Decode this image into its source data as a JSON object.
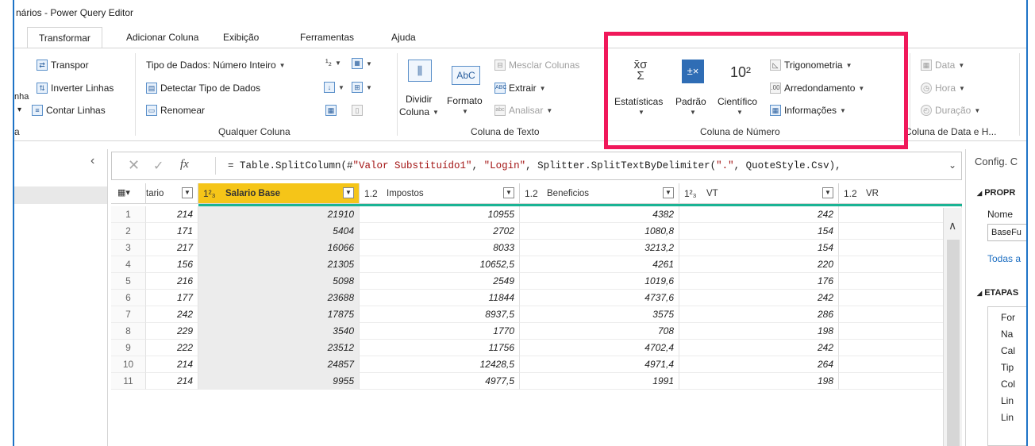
{
  "window": {
    "title": "nários - Power Query Editor"
  },
  "tabs": [
    "Transformar",
    "Adicionar Coluna",
    "Exibição",
    "Ferramentas",
    "Ajuda"
  ],
  "ribbon": {
    "group0": {
      "label": "a",
      "partial_text": "nha"
    },
    "group1": {
      "transpor": "Transpor",
      "inverter": "Inverter Linhas",
      "contar": "Contar Linhas"
    },
    "qualquer": {
      "tipo_dados": "Tipo de Dados: Número Inteiro",
      "detectar": "Detectar Tipo de Dados",
      "renomear": "Renomear",
      "label": "Qualquer Coluna"
    },
    "texto": {
      "dividir": "Dividir",
      "coluna": "Coluna",
      "formato": "Formato",
      "mesclar": "Mesclar Colunas",
      "extrair": "Extrair",
      "analisar": "Analisar",
      "label": "Coluna de Texto"
    },
    "numero": {
      "estatisticas": "Estatísticas",
      "padrao": "Padrão",
      "cientifico": "Científico",
      "trigonometria": "Trigonometria",
      "arredondamento": "Arredondamento",
      "informacoes": "Informações",
      "label": "Coluna de Número"
    },
    "data": {
      "data": "Data",
      "hora": "Hora",
      "duracao": "Duração",
      "label": "Coluna de Data e H..."
    }
  },
  "formula": {
    "fx": "fx",
    "prefix": "= Table.SplitColumn(#",
    "str1": "\"Valor Substituído1\"",
    "mid1": ", ",
    "str2": "\"Login\"",
    "mid2": ", Splitter.SplitTextByDelimiter(",
    "str3": "\".\"",
    "suffix": ", QuoteStyle.Csv),"
  },
  "table": {
    "columns": [
      {
        "type": "",
        "name": "tario"
      },
      {
        "type": "1²₃",
        "name": "Salario Base"
      },
      {
        "type": "1.2",
        "name": "Impostos"
      },
      {
        "type": "1.2",
        "name": "Beneficios"
      },
      {
        "type": "1²₃",
        "name": "VT"
      },
      {
        "type": "1.2",
        "name": "VR"
      }
    ],
    "rows": [
      [
        "1",
        "214",
        "21910",
        "10955",
        "4382",
        "242",
        ""
      ],
      [
        "2",
        "171",
        "5404",
        "2702",
        "1080,8",
        "154",
        ""
      ],
      [
        "3",
        "217",
        "16066",
        "8033",
        "3213,2",
        "154",
        ""
      ],
      [
        "4",
        "156",
        "21305",
        "10652,5",
        "4261",
        "220",
        ""
      ],
      [
        "5",
        "216",
        "5098",
        "2549",
        "1019,6",
        "176",
        ""
      ],
      [
        "6",
        "177",
        "23688",
        "11844",
        "4737,6",
        "242",
        ""
      ],
      [
        "7",
        "242",
        "17875",
        "8937,5",
        "3575",
        "286",
        ""
      ],
      [
        "8",
        "229",
        "3540",
        "1770",
        "708",
        "198",
        ""
      ],
      [
        "9",
        "222",
        "23512",
        "11756",
        "4702,4",
        "242",
        ""
      ],
      [
        "10",
        "214",
        "24857",
        "12428,5",
        "4971,4",
        "264",
        ""
      ],
      [
        "11",
        "214",
        "9955",
        "4977,5",
        "1991",
        "198",
        ""
      ]
    ]
  },
  "rightpane": {
    "config": "Config. C",
    "propriedades": "PROPR",
    "nome": "Nome",
    "nome_value": "BaseFu",
    "todas": "Todas a",
    "etapas": "ETAPAS",
    "steps": [
      "For",
      "Na",
      "Cal",
      "Tip",
      "Col",
      "Lin",
      "Lin"
    ]
  },
  "colors": {
    "highlight": "#f0185a",
    "active_header": "#f5c518",
    "teal": "#1ab394",
    "accent": "#1e73c6"
  }
}
